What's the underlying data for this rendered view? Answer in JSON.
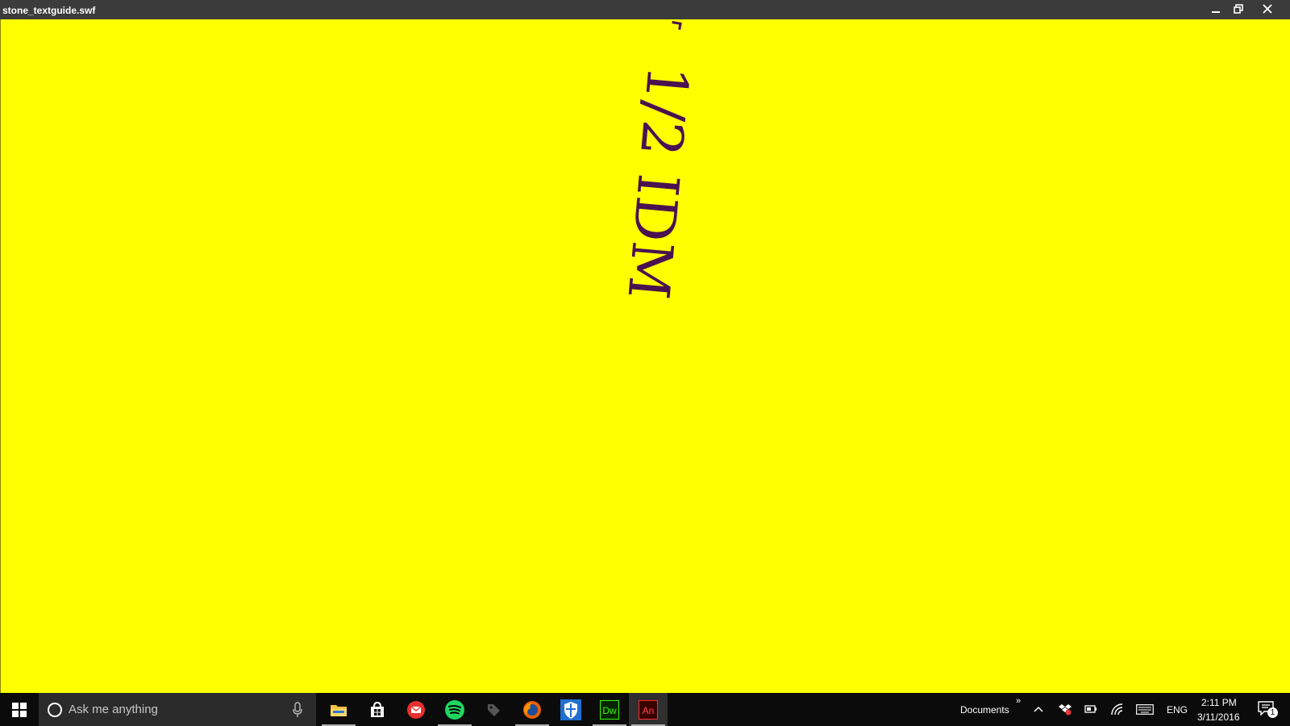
{
  "window": {
    "title": "stone_textguide.swf",
    "controls": [
      "minimize-icon",
      "restore-icon",
      "close-icon"
    ]
  },
  "stage": {
    "background": "#ffff00",
    "text_color": "#4a1250",
    "rotated_text": "1/2 IDM"
  },
  "taskbar": {
    "search_placeholder": "Ask me anything",
    "apps": [
      {
        "icon": "file-explorer-icon",
        "running": true
      },
      {
        "icon": "store-icon",
        "running": false
      },
      {
        "icon": "mail-icon",
        "running": false
      },
      {
        "icon": "spotify-icon",
        "running": true
      },
      {
        "icon": "tag-app-icon",
        "running": false
      },
      {
        "icon": "firefox-icon",
        "running": true
      },
      {
        "icon": "defender-icon",
        "running": false
      },
      {
        "icon": "dreamweaver-icon",
        "running": true,
        "label": "Dw"
      },
      {
        "icon": "animate-icon",
        "running": true,
        "active": true,
        "label": "An"
      }
    ],
    "toolbar_label": "Documents",
    "toolbar_chevron": "»",
    "language": "ENG",
    "time": "2:11 PM",
    "date": "3/11/2016",
    "notification_count": "1"
  }
}
